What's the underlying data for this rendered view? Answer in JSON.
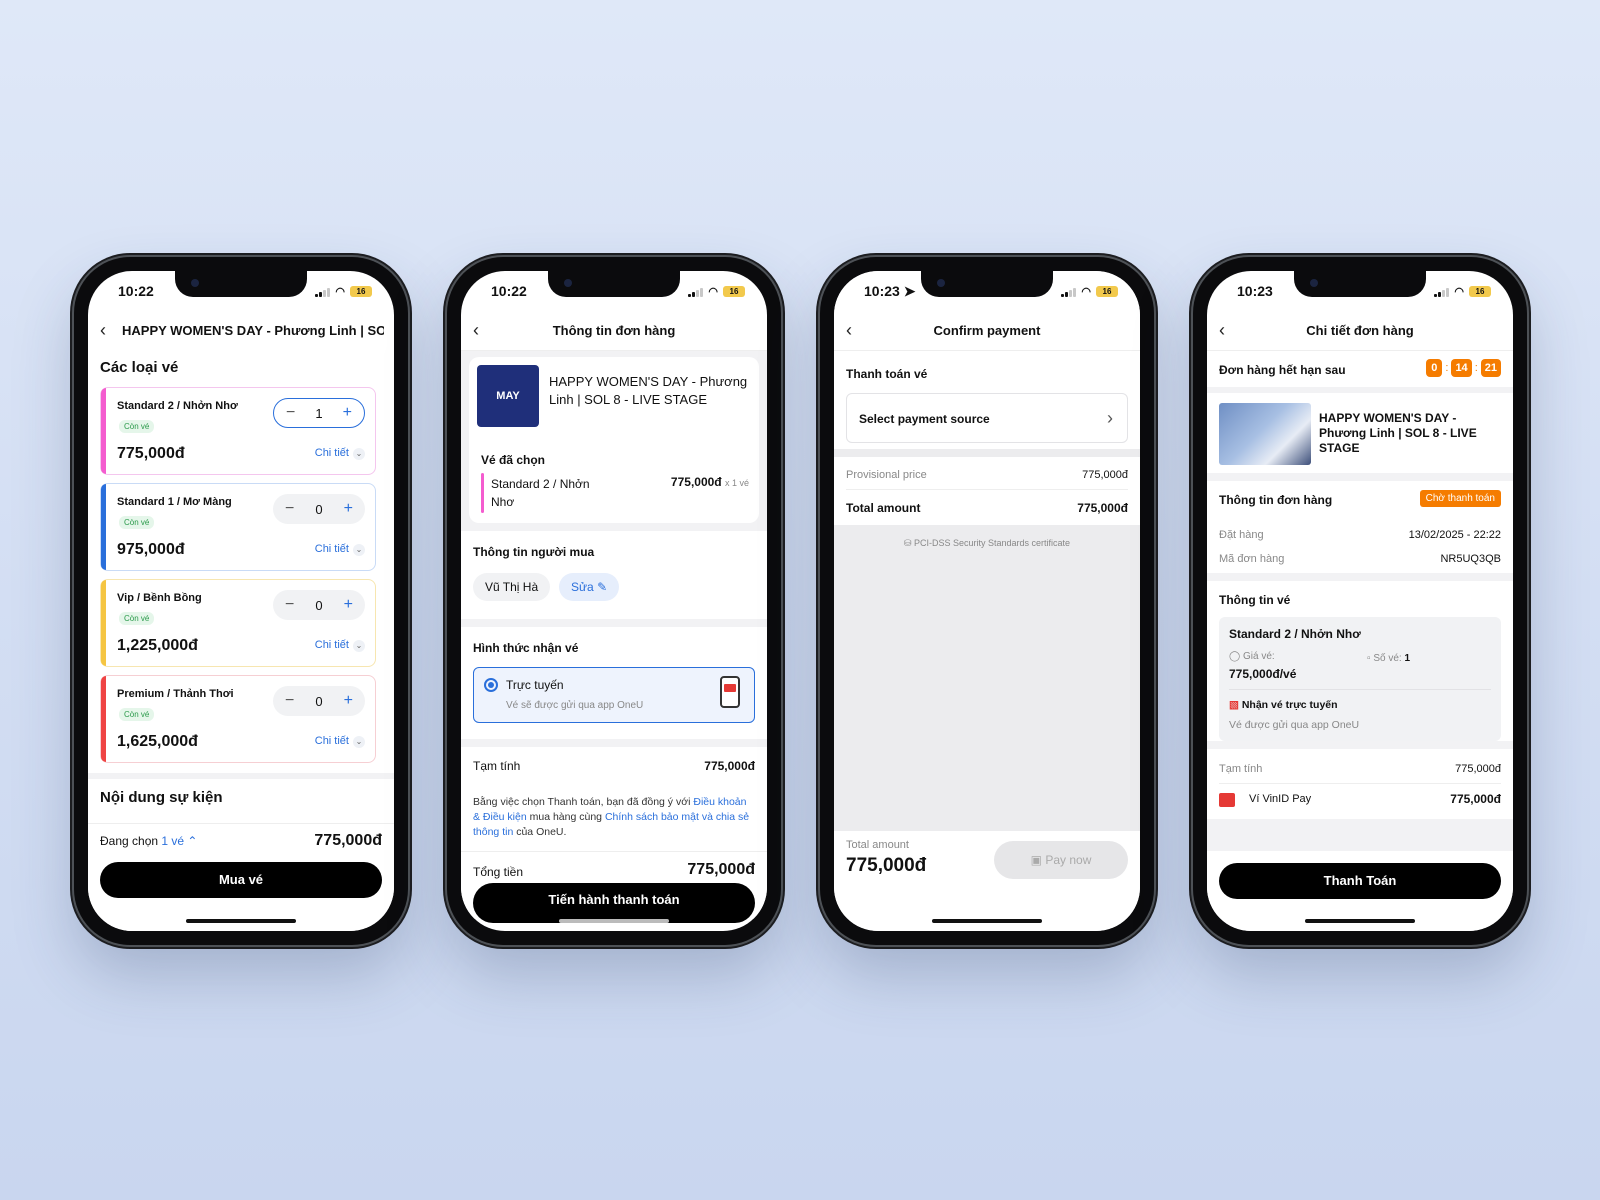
{
  "phones": [
    {
      "time": "10:22",
      "battery": "16",
      "nav_title": "HAPPY WOMEN'S DAY - Phương Linh | SO...",
      "section_title": "Các loại vé",
      "tickets": [
        {
          "name": "Standard 2 / Nhởn Nhơ",
          "status": "Còn vé",
          "price": "775,000đ",
          "qty": "1",
          "detail": "Chi tiết",
          "color": "#f45ccf"
        },
        {
          "name": "Standard 1 / Mơ Màng",
          "status": "Còn vé",
          "price": "975,000đ",
          "qty": "0",
          "detail": "Chi tiết",
          "color": "#2a6fdb"
        },
        {
          "name": "Vip / Bềnh Bồng",
          "status": "Còn vé",
          "price": "1,225,000đ",
          "qty": "0",
          "detail": "Chi tiết",
          "color": "#f5c542"
        },
        {
          "name": "Premium / Thảnh Thơi",
          "status": "Còn vé",
          "price": "1,625,000đ",
          "qty": "0",
          "detail": "Chi tiết",
          "color": "#ef4444"
        }
      ],
      "event_section": "Nội dung sự kiện",
      "selected_label": "Đang chọn",
      "selected_count": "1 vé",
      "total": "775,000đ",
      "buy_button": "Mua vé"
    },
    {
      "time": "10:22",
      "battery": "16",
      "nav_title": "Thông tin đơn hàng",
      "event_name": "HAPPY WOMEN'S DAY - Phương Linh | SOL 8 - LIVE STAGE",
      "logo_text": "MAY",
      "selected_title": "Vé đã chọn",
      "selected_ticket": "Standard 2 / Nhởn Nhơ",
      "selected_price": "775,000đ",
      "selected_qty": "x 1 vé",
      "buyer_title": "Thông tin người mua",
      "buyer_name": "Vũ Thị Hà",
      "edit_label": "Sửa",
      "delivery_title": "Hình thức nhận vé",
      "delivery_option": "Trực tuyến",
      "delivery_desc": "Vé sẽ được gửi qua app OneU",
      "subtotal_label": "Tạm tính",
      "subtotal_value": "775,000đ",
      "terms_1": "Bằng việc chọn Thanh toán, bạn đã đồng ý với",
      "terms_link_1": "Điều khoản & Điều kiện",
      "terms_2": "mua hàng cùng",
      "terms_link_2": "Chính sách bảo mật và chia sẻ thông tin",
      "terms_3": "của OneU.",
      "total_label": "Tổng tiền",
      "total_value": "775,000đ",
      "pay_button": "Tiến hành thanh toán"
    },
    {
      "time": "10:23",
      "battery": "16",
      "nav_title": "Confirm payment",
      "section_title": "Thanh toán vé",
      "payment_source": "Select payment source",
      "provisional_label": "Provisional price",
      "provisional_value": "775,000đ",
      "total_label": "Total amount",
      "total_value": "775,000đ",
      "pci": "PCI-DSS Security Standards certificate",
      "footer_label": "Total amount",
      "footer_value": "775,000đ",
      "pay_button": "Pay now"
    },
    {
      "time": "10:23",
      "battery": "16",
      "nav_title": "Chi tiết đơn hàng",
      "expiry_label": "Đơn hàng hết hạn sau",
      "timer": [
        "0",
        "14",
        "21"
      ],
      "event_name": "HAPPY WOMEN'S DAY - Phương Linh | SOL 8 - LIVE STAGE",
      "order_title": "Thông tin đơn hàng",
      "order_status": "Chờ thanh toán",
      "ordered_label": "Đặt hàng",
      "ordered_value": "13/02/2025 - 22:22",
      "code_label": "Mã đơn hàng",
      "code_value": "NR5UQ3QB",
      "ticket_info_title": "Thông tin vé",
      "ticket_name": "Standard 2 / Nhởn Nhơ",
      "price_label": "Giá vé:",
      "price_value": "775,000đ/vé",
      "qty_label": "Số vé:",
      "qty_value": "1",
      "delivery_label": "Nhận vé trực tuyến",
      "delivery_desc": "Vé được gửi qua app OneU",
      "subtotal_label": "Tạm tính",
      "subtotal_value": "775,000đ",
      "wallet_label": "Ví VinID Pay",
      "wallet_value": "775,000đ",
      "pay_button": "Thanh Toán"
    }
  ]
}
